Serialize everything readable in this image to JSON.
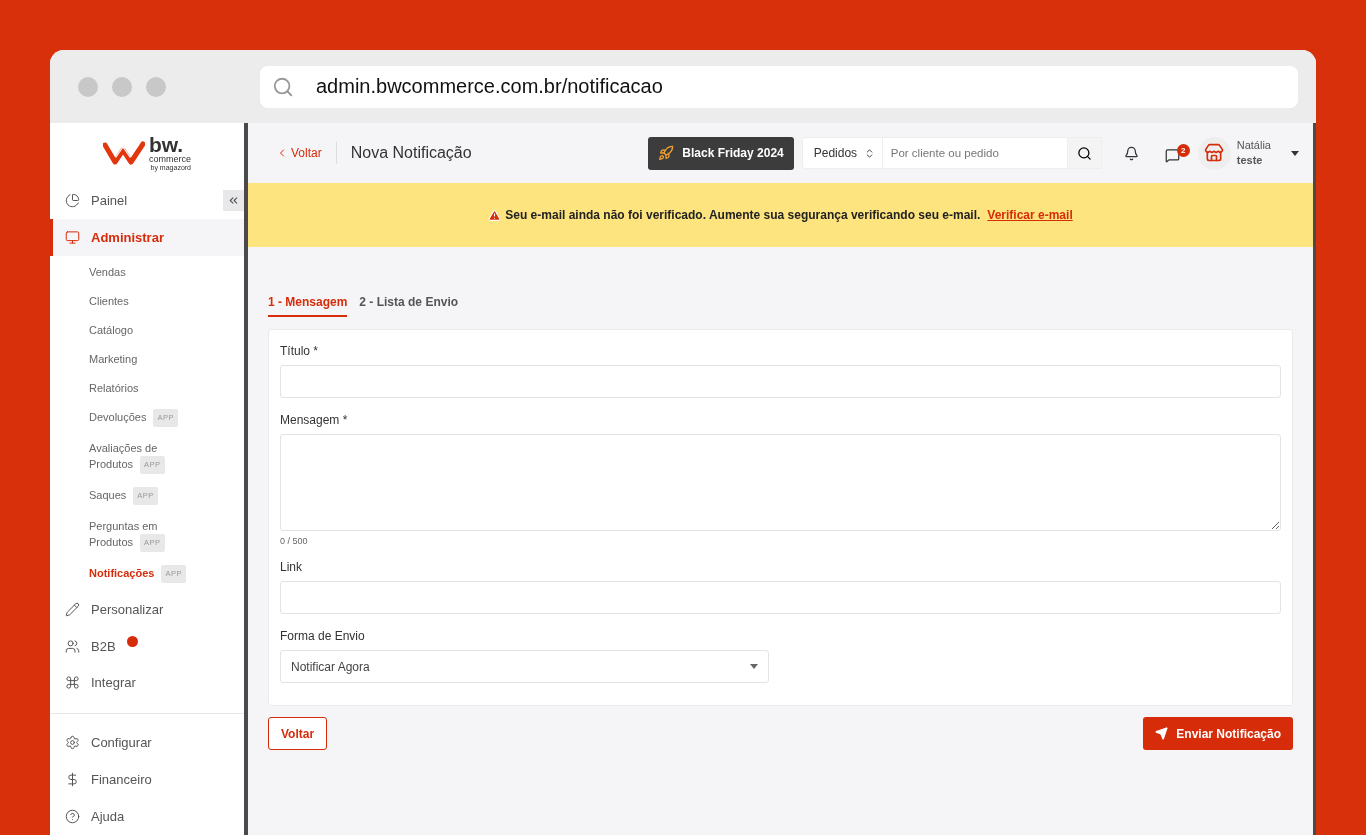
{
  "browser": {
    "url": "admin.bwcommerce.com.br/notificacao"
  },
  "logo": {
    "name": "bw.",
    "tagline": "commerce",
    "byline": "by magazord"
  },
  "sidebar": {
    "sections": [
      {
        "items": [
          {
            "label": "Painel",
            "selected": false
          },
          {
            "label": "Administrar",
            "selected": true,
            "children": [
              {
                "label": "Vendas",
                "selected": false
              },
              {
                "label": "Clientes",
                "selected": false
              },
              {
                "label": "Catálogo",
                "selected": false
              },
              {
                "label": "Marketing",
                "selected": false
              },
              {
                "label": "Relatórios",
                "selected": false
              },
              {
                "label": "Devoluções",
                "selected": false,
                "badge": "APP"
              },
              {
                "label": "Avaliações de Produtos",
                "selected": false,
                "badge": "APP"
              },
              {
                "label": "Saques",
                "selected": false,
                "badge": "APP"
              },
              {
                "label": "Perguntas em Produtos",
                "selected": false,
                "badge": "APP"
              },
              {
                "label": "Notificações",
                "selected": true,
                "badge": "APP"
              }
            ]
          },
          {
            "label": "Personalizar",
            "selected": false
          },
          {
            "label": "B2B",
            "selected": false,
            "flagged": true
          },
          {
            "label": "Integrar",
            "selected": false
          }
        ]
      },
      {
        "items": [
          {
            "label": "Configurar",
            "selected": false
          },
          {
            "label": "Financeiro",
            "selected": false
          },
          {
            "label": "Ajuda",
            "selected": false
          }
        ]
      }
    ]
  },
  "header": {
    "back": "Voltar",
    "title": "Nova Notificação",
    "promo": "Black Friday 2024",
    "search_scope": "Pedidos",
    "search": {
      "placeholder": "Por cliente ou pedido"
    },
    "messages_count": "2",
    "user": {
      "name": "Natália",
      "store": "teste"
    }
  },
  "banner": {
    "text": "Seu e-mail ainda não foi verificado. Aumente sua segurança verificando seu e-mail.",
    "link": "Verificar e-mail"
  },
  "tabs": [
    {
      "label": "1 - Mensagem",
      "selected": true
    },
    {
      "label": "2 - Lista de Envio",
      "selected": false
    }
  ],
  "form": {
    "fields": [
      {
        "kind": "text",
        "label": "Título *"
      },
      {
        "kind": "textarea",
        "label": "Mensagem *",
        "counter": "0 / 500"
      },
      {
        "kind": "text",
        "label": "Link"
      },
      {
        "kind": "select",
        "label": "Forma de Envio",
        "value": "Notificar Agora"
      }
    ]
  },
  "buttons": [
    {
      "kind": "secondary",
      "label": "Voltar"
    },
    {
      "kind": "primary",
      "label": "Enviar Notificação"
    }
  ]
}
